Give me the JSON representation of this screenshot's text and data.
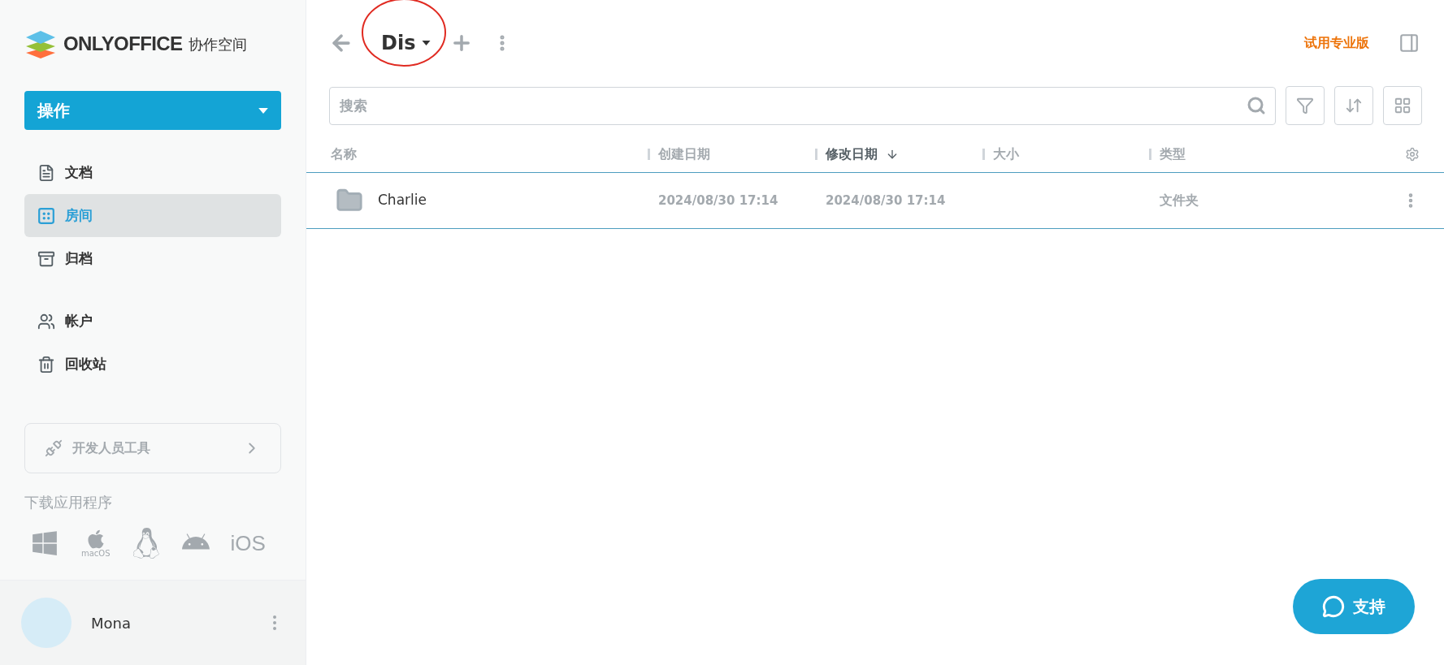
{
  "logo": {
    "brand": "ONLYOFFICE",
    "product": "协作空间"
  },
  "actions_button": {
    "label": "操作"
  },
  "nav_main": [
    {
      "kind": "documents",
      "label": "文档",
      "selected": false
    },
    {
      "kind": "rooms",
      "label": "房间",
      "selected": true
    },
    {
      "kind": "archive",
      "label": "归档",
      "selected": false
    }
  ],
  "nav_other": [
    {
      "kind": "accounts",
      "label": "帐户",
      "selected": false
    },
    {
      "kind": "trash",
      "label": "回收站",
      "selected": false
    }
  ],
  "developer_tools": {
    "label": "开发人员工具"
  },
  "download": {
    "title": "下载应用程序",
    "platforms": [
      {
        "kind": "windows"
      },
      {
        "kind": "macos",
        "label": "macOS"
      },
      {
        "kind": "linux"
      },
      {
        "kind": "android"
      },
      {
        "kind": "ios",
        "label": "iOS"
      }
    ]
  },
  "user": {
    "name": "Mona"
  },
  "header": {
    "title": "Dis",
    "trial_link": "试用专业版"
  },
  "search": {
    "placeholder": "搜索"
  },
  "table": {
    "columns": [
      {
        "label": "名称",
        "sorted": false
      },
      {
        "label": "创建日期",
        "sorted": false
      },
      {
        "label": "修改日期",
        "sorted": true
      },
      {
        "label": "大小",
        "sorted": false
      },
      {
        "label": "类型",
        "sorted": false
      }
    ],
    "rows": [
      {
        "name": "Charlie",
        "created": "2024/08/30 17:14",
        "modified": "2024/08/30 17:14",
        "type": "文件夹"
      }
    ]
  },
  "support_button": {
    "label": "支持"
  }
}
